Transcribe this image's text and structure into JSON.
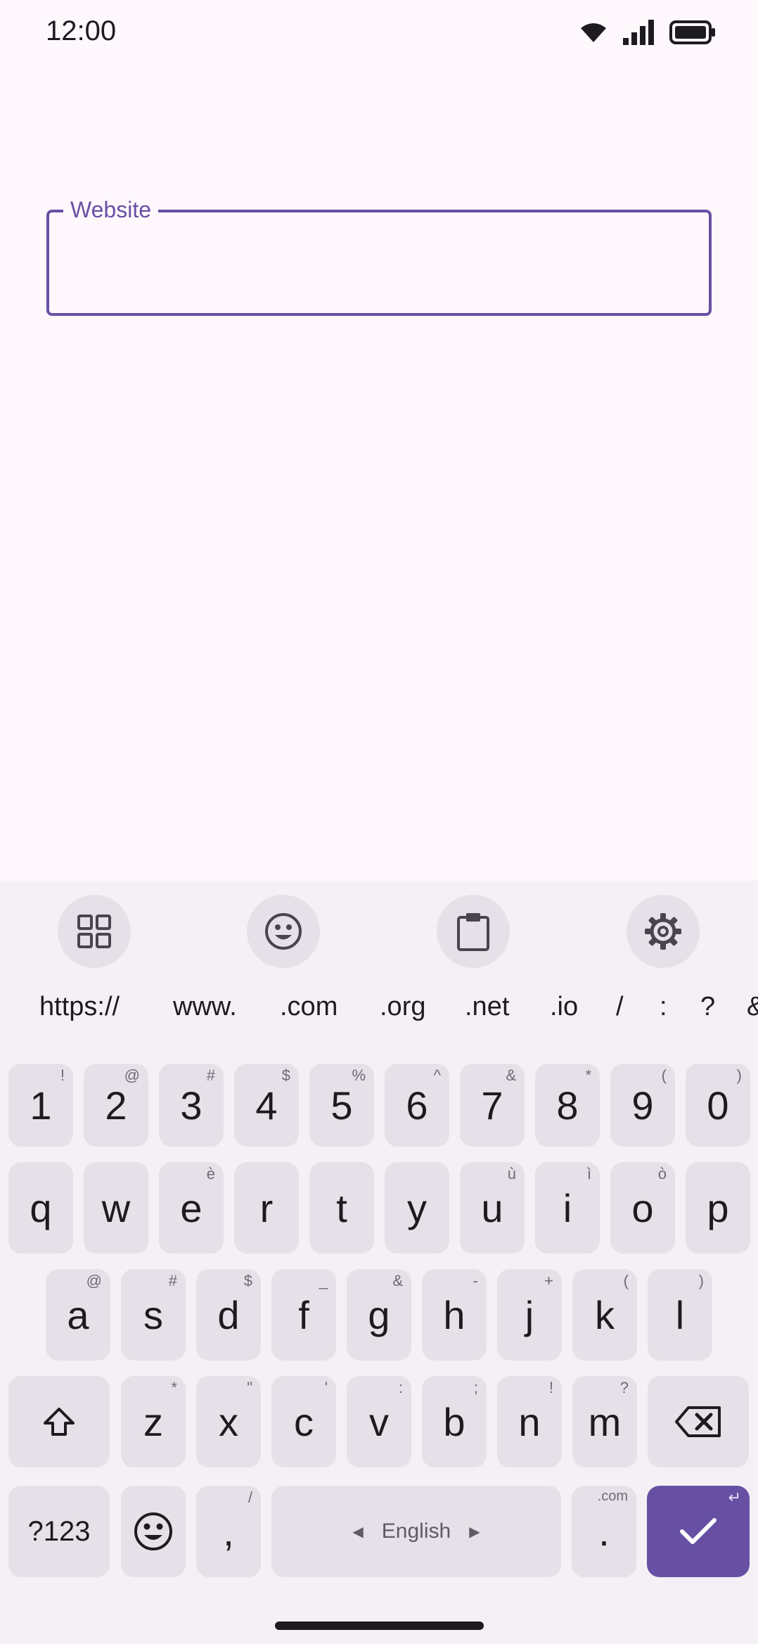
{
  "status": {
    "time": "12:00"
  },
  "field": {
    "label": "Website",
    "value": "",
    "accent": "#6750a4"
  },
  "keyboard": {
    "suggestions": [
      "https://",
      "www.",
      ".com",
      ".org",
      ".net",
      ".io",
      "/",
      ":",
      "?",
      "&"
    ],
    "row1": [
      {
        "k": "1",
        "h": "!"
      },
      {
        "k": "2",
        "h": "@"
      },
      {
        "k": "3",
        "h": "#"
      },
      {
        "k": "4",
        "h": "$"
      },
      {
        "k": "5",
        "h": "%"
      },
      {
        "k": "6",
        "h": "^"
      },
      {
        "k": "7",
        "h": "&"
      },
      {
        "k": "8",
        "h": "*"
      },
      {
        "k": "9",
        "h": "("
      },
      {
        "k": "0",
        "h": ")"
      }
    ],
    "row2": [
      {
        "k": "q",
        "h": ""
      },
      {
        "k": "w",
        "h": ""
      },
      {
        "k": "e",
        "h": "è"
      },
      {
        "k": "r",
        "h": ""
      },
      {
        "k": "t",
        "h": ""
      },
      {
        "k": "y",
        "h": ""
      },
      {
        "k": "u",
        "h": "ù"
      },
      {
        "k": "i",
        "h": "ì"
      },
      {
        "k": "o",
        "h": "ò"
      },
      {
        "k": "p",
        "h": ""
      }
    ],
    "row3": [
      {
        "k": "a",
        "h": "@"
      },
      {
        "k": "s",
        "h": "#"
      },
      {
        "k": "d",
        "h": "$"
      },
      {
        "k": "f",
        "h": "_"
      },
      {
        "k": "g",
        "h": "&"
      },
      {
        "k": "h",
        "h": "-"
      },
      {
        "k": "j",
        "h": "+"
      },
      {
        "k": "k",
        "h": "("
      },
      {
        "k": "l",
        "h": ")"
      }
    ],
    "row4": [
      {
        "k": "z",
        "h": "*"
      },
      {
        "k": "x",
        "h": "\""
      },
      {
        "k": "c",
        "h": "'"
      },
      {
        "k": "v",
        "h": ":"
      },
      {
        "k": "b",
        "h": ";"
      },
      {
        "k": "n",
        "h": "!"
      },
      {
        "k": "m",
        "h": "?"
      }
    ],
    "symbols_label": "?123",
    "comma": {
      "k": ",",
      "h": "/"
    },
    "space_label": "English",
    "period": {
      "k": ".",
      "h": ".com"
    },
    "enter_hint": "↵"
  }
}
